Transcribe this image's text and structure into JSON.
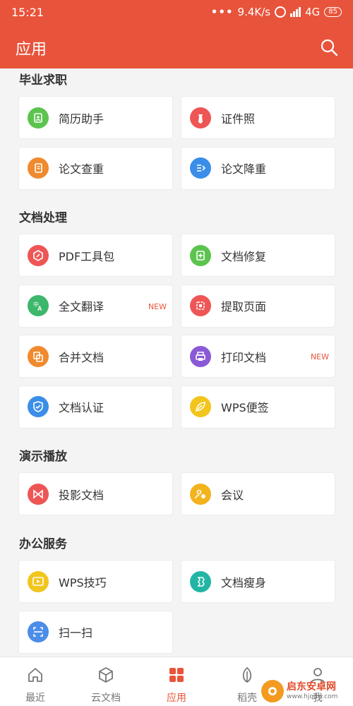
{
  "status": {
    "time": "15:21",
    "speed": "9.4K/s",
    "network": "4G",
    "battery": "85"
  },
  "header": {
    "title": "应用"
  },
  "sections": [
    {
      "title": "毕业求职",
      "items": [
        {
          "label": "简历助手",
          "color": "#5cc44e",
          "icon": "resume-icon"
        },
        {
          "label": "证件照",
          "color": "#ee5656",
          "icon": "id-photo-icon"
        },
        {
          "label": "论文查重",
          "color": "#f08a2e",
          "icon": "paper-check-icon"
        },
        {
          "label": "论文降重",
          "color": "#3a8ee8",
          "icon": "paper-reduce-icon"
        }
      ]
    },
    {
      "title": "文档处理",
      "items": [
        {
          "label": "PDF工具包",
          "color": "#ee5656",
          "icon": "pdf-icon"
        },
        {
          "label": "文档修复",
          "color": "#5cc44e",
          "icon": "repair-icon"
        },
        {
          "label": "全文翻译",
          "color": "#3db76b",
          "icon": "translate-icon",
          "badge": "NEW"
        },
        {
          "label": "提取页面",
          "color": "#ee5656",
          "icon": "extract-icon"
        },
        {
          "label": "合并文档",
          "color": "#f08a2e",
          "icon": "merge-icon"
        },
        {
          "label": "打印文档",
          "color": "#8a5ad6",
          "icon": "print-icon",
          "badge": "NEW"
        },
        {
          "label": "文档认证",
          "color": "#3a8ee8",
          "icon": "shield-icon"
        },
        {
          "label": "WPS便签",
          "color": "#f2c51d",
          "icon": "leaf-icon"
        }
      ]
    },
    {
      "title": "演示播放",
      "items": [
        {
          "label": "投影文档",
          "color": "#ee5656",
          "icon": "projection-icon"
        },
        {
          "label": "会议",
          "color": "#f2b31d",
          "icon": "meeting-icon"
        }
      ]
    },
    {
      "title": "办公服务",
      "items": [
        {
          "label": "WPS技巧",
          "color": "#f2c51d",
          "icon": "play-icon"
        },
        {
          "label": "文档瘦身",
          "color": "#23b5a4",
          "icon": "slim-icon"
        },
        {
          "label": "扫一扫",
          "color": "#4b8de8",
          "icon": "scan-icon"
        }
      ]
    }
  ],
  "nav": [
    {
      "label": "最近",
      "icon": "home-icon"
    },
    {
      "label": "云文档",
      "icon": "cube-icon"
    },
    {
      "label": "应用",
      "icon": "apps-icon",
      "active": true
    },
    {
      "label": "稻壳",
      "icon": "leaf-nav-icon"
    },
    {
      "label": "我",
      "icon": "user-icon"
    }
  ],
  "watermark": {
    "line1": "启东安卓网",
    "line2": "www.hjqdw.com"
  },
  "colors": {
    "accent": "#e8543b"
  }
}
